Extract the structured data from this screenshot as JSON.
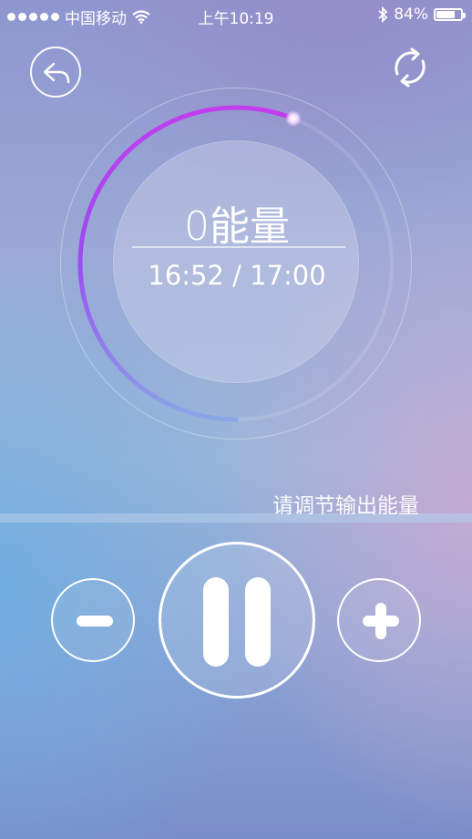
{
  "status_bar": {
    "carrier": "中国移动",
    "time": "上午10:19",
    "battery_text": "84%",
    "battery_level": 0.84
  },
  "top_bar": {
    "back_icon": "reply-arrow-icon",
    "refresh_icon": "refresh-icon"
  },
  "dial": {
    "energy_text": "0能量",
    "time_text": "16:52 / 17:00",
    "progress": 0.56,
    "colors": {
      "start": "#c23cf0",
      "end": "#8aa6e6"
    }
  },
  "control": {
    "hint": "请调节输出能量",
    "decrease_icon": "minus-icon",
    "pause_icon": "pause-icon",
    "increase_icon": "plus-icon"
  }
}
